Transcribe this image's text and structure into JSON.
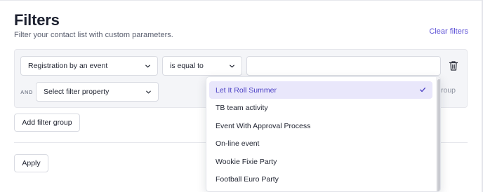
{
  "header": {
    "title": "Filters",
    "subtitle": "Filter your contact list with custom parameters.",
    "clear_label": "Clear filters"
  },
  "filter_group": {
    "row1": {
      "field_value": "Registration by an event",
      "operator_value": "is equal to",
      "value_input": ""
    },
    "row2": {
      "connector": "AND",
      "property_placeholder": "Select filter property",
      "partial_button_text": "roup"
    }
  },
  "buttons": {
    "add_group_label": "Add filter group",
    "apply_label": "Apply"
  },
  "dropdown": {
    "selected": "Let It Roll Summer",
    "options": [
      "Let It Roll Summer",
      "TB team activity",
      "Event With Approval Process",
      "On-line event",
      "Wookie Fixie Party",
      "Football Euro Party"
    ]
  },
  "colors": {
    "accent": "#5b4fd6",
    "selected_bg": "#e9e7fb",
    "panel_bg": "#f4f5f8"
  },
  "icons": [
    "chevron-down-icon",
    "trash-icon",
    "check-icon"
  ]
}
